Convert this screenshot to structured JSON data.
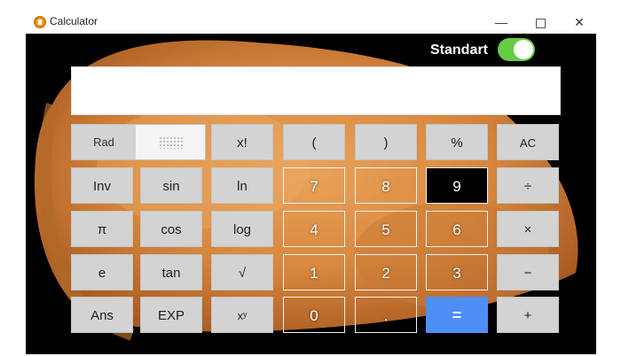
{
  "window": {
    "title": "Calculator",
    "controls": {
      "minimize": "—",
      "maximize": "",
      "close": "✕"
    }
  },
  "mode": {
    "label": "Standart",
    "toggle_on": true,
    "toggle_color": "#66cc44"
  },
  "display": {
    "value": ""
  },
  "keys": {
    "rad": "Rad",
    "factorial": "x!",
    "open_paren": "(",
    "close_paren": ")",
    "percent": "%",
    "ac": "AC",
    "inv": "Inv",
    "sin": "sin",
    "ln": "ln",
    "seven": "7",
    "eight": "8",
    "nine": "9",
    "divide": "÷",
    "pi": "π",
    "cos": "cos",
    "log": "log",
    "four": "4",
    "five": "5",
    "six": "6",
    "multiply": "×",
    "e": "e",
    "tan": "tan",
    "sqrt": "√",
    "one": "1",
    "two": "2",
    "three": "3",
    "minus": "−",
    "ans": "Ans",
    "exp": "EXP",
    "power": "xʸ",
    "zero": "0",
    "dot": ".",
    "equals": "=",
    "plus": "+"
  },
  "colors": {
    "equals_key": "#4e8ef7",
    "function_key": "#d3d3d3",
    "background": "#000000"
  }
}
